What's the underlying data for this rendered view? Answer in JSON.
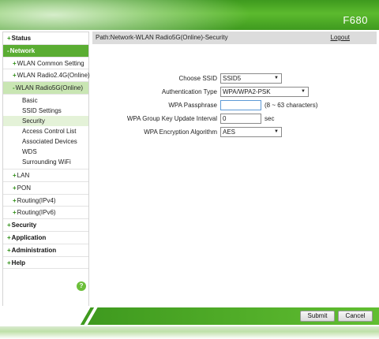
{
  "header": {
    "model": "F680"
  },
  "sidebar": {
    "status": {
      "sign": "+",
      "label": "Status"
    },
    "network": {
      "sign": "-",
      "label": "Network"
    },
    "network_items": [
      {
        "sign": "+",
        "label": "WLAN Common Setting"
      },
      {
        "sign": "+",
        "label": "WLAN Radio2.4G(Online)"
      },
      {
        "sign": "-",
        "label": "WLAN Radio5G(Online)"
      }
    ],
    "radio5g_subitems": [
      "Basic",
      "SSID Settings",
      "Security",
      "Access Control List",
      "Associated Devices",
      "WDS",
      "Surrounding WiFi"
    ],
    "network_tail": [
      {
        "sign": "+",
        "label": "LAN"
      },
      {
        "sign": "+",
        "label": "PON"
      },
      {
        "sign": "+",
        "label": "Routing(IPv4)"
      },
      {
        "sign": "+",
        "label": "Routing(IPv6)"
      }
    ],
    "top_level": [
      {
        "sign": "+",
        "label": "Security"
      },
      {
        "sign": "+",
        "label": "Application"
      },
      {
        "sign": "+",
        "label": "Administration"
      },
      {
        "sign": "+",
        "label": "Help"
      }
    ],
    "help_glyph": "?"
  },
  "content": {
    "path": "Path:Network-WLAN Radio5G(Online)-Security",
    "logout": "Logout"
  },
  "form": {
    "ssid": {
      "label": "Choose SSID",
      "value": "SSID5"
    },
    "auth": {
      "label": "Authentication Type",
      "value": "WPA/WPA2-PSK"
    },
    "passphrase": {
      "label": "WPA Passphrase",
      "value": "",
      "hint": "(8 ~ 63 characters)"
    },
    "rekey": {
      "label": "WPA Group Key Update Interval",
      "value": "0",
      "unit": "sec"
    },
    "encryption": {
      "label": "WPA Encryption Algorithm",
      "value": "AES"
    },
    "dropdown_glyph": "▼"
  },
  "footer": {
    "submit": "Submit",
    "cancel": "Cancel"
  },
  "colors": {
    "brand_green": "#5aad32",
    "active_sub": "#c9e6b3"
  }
}
